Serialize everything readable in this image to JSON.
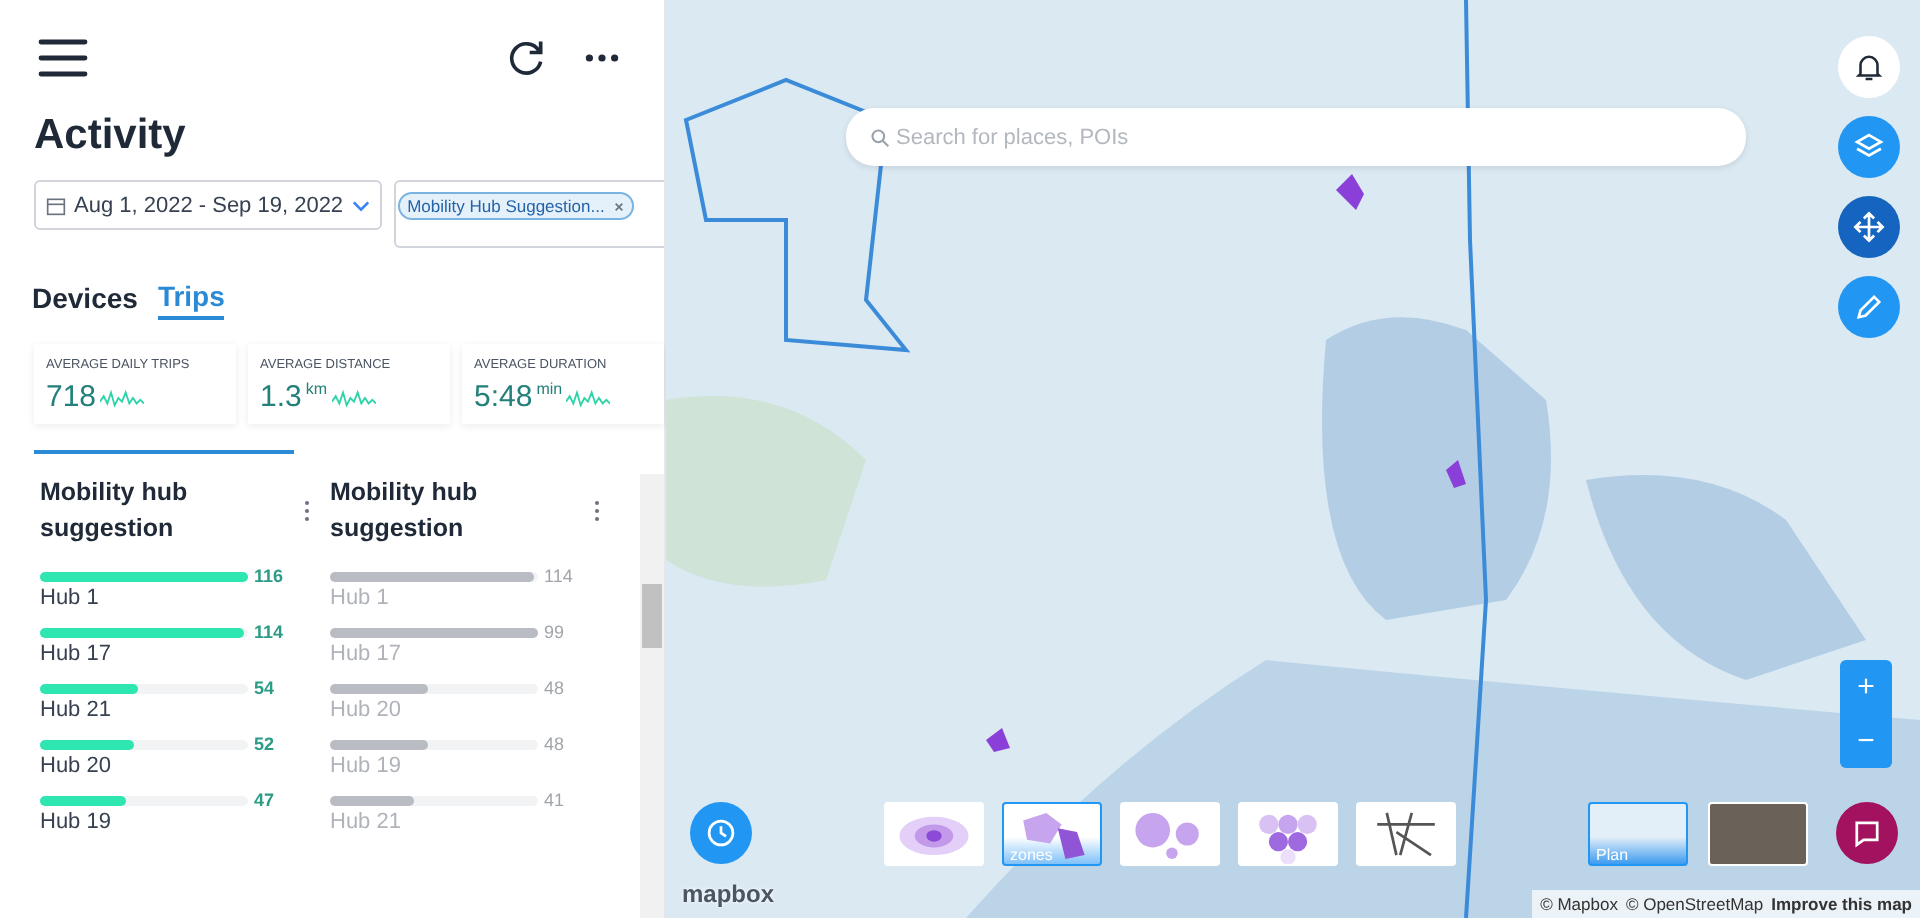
{
  "header": {
    "title": "Activity"
  },
  "filters": {
    "date_range": "Aug 1, 2022 - Sep 19, 2022",
    "chips": [
      {
        "label": "Mobility Hub Suggestion..."
      }
    ]
  },
  "tabs": [
    {
      "label": "Devices",
      "selected": false
    },
    {
      "label": "Trips",
      "selected": true
    }
  ],
  "stats": [
    {
      "label": "AVERAGE DAILY TRIPS",
      "value": "718"
    },
    {
      "label": "AVERAGE DISTANCE",
      "value": "1.3",
      "unit": "km"
    },
    {
      "label": "AVERAGE DURATION",
      "value": "5:48",
      "unit": "min"
    }
  ],
  "columns": [
    {
      "title": "Mobility hub suggestion",
      "highlighted": true,
      "rows": [
        {
          "label": "Hub 1",
          "value": "116",
          "level": 1
        },
        {
          "label": "Hub 17",
          "value": "114",
          "level": 0.98
        },
        {
          "label": "Hub 21",
          "value": "54",
          "level": 0.47
        },
        {
          "label": "Hub 20",
          "value": "52",
          "level": 0.45
        },
        {
          "label": "Hub 19",
          "value": "47",
          "level": 0.41
        }
      ]
    },
    {
      "title": "Mobility hub suggestion",
      "highlighted": false,
      "rows": [
        {
          "label": "Hub 1",
          "value": "114",
          "level": 0.98
        },
        {
          "label": "Hub 17",
          "value": "99",
          "level": 1
        },
        {
          "label": "Hub 20",
          "value": "48",
          "level": 0.47
        },
        {
          "label": "Hub 19",
          "value": "48",
          "level": 0.47
        },
        {
          "label": "Hub 21",
          "value": "41",
          "level": 0.4
        }
      ]
    }
  ],
  "map": {
    "search": {
      "placeholder": "Search for places, POIs"
    },
    "layer_styles": [
      {
        "kind": "heatmap",
        "selected": false
      },
      {
        "kind": "zones",
        "label": "zones",
        "selected": true
      },
      {
        "kind": "bubbles",
        "selected": false
      },
      {
        "kind": "hexagons",
        "selected": false
      },
      {
        "kind": "lines",
        "selected": false
      }
    ],
    "base_maps": [
      {
        "kind": "plan",
        "label": "Plan",
        "selected": true
      },
      {
        "kind": "satellite",
        "selected": false
      }
    ],
    "zoom": {
      "in": "+",
      "out": "−"
    },
    "logo": "mapbox",
    "attribution": [
      {
        "text": "© Mapbox",
        "bold": false
      },
      {
        "text": "© OpenStreetMap",
        "bold": false
      },
      {
        "text": "Improve this map",
        "bold": true
      }
    ]
  }
}
